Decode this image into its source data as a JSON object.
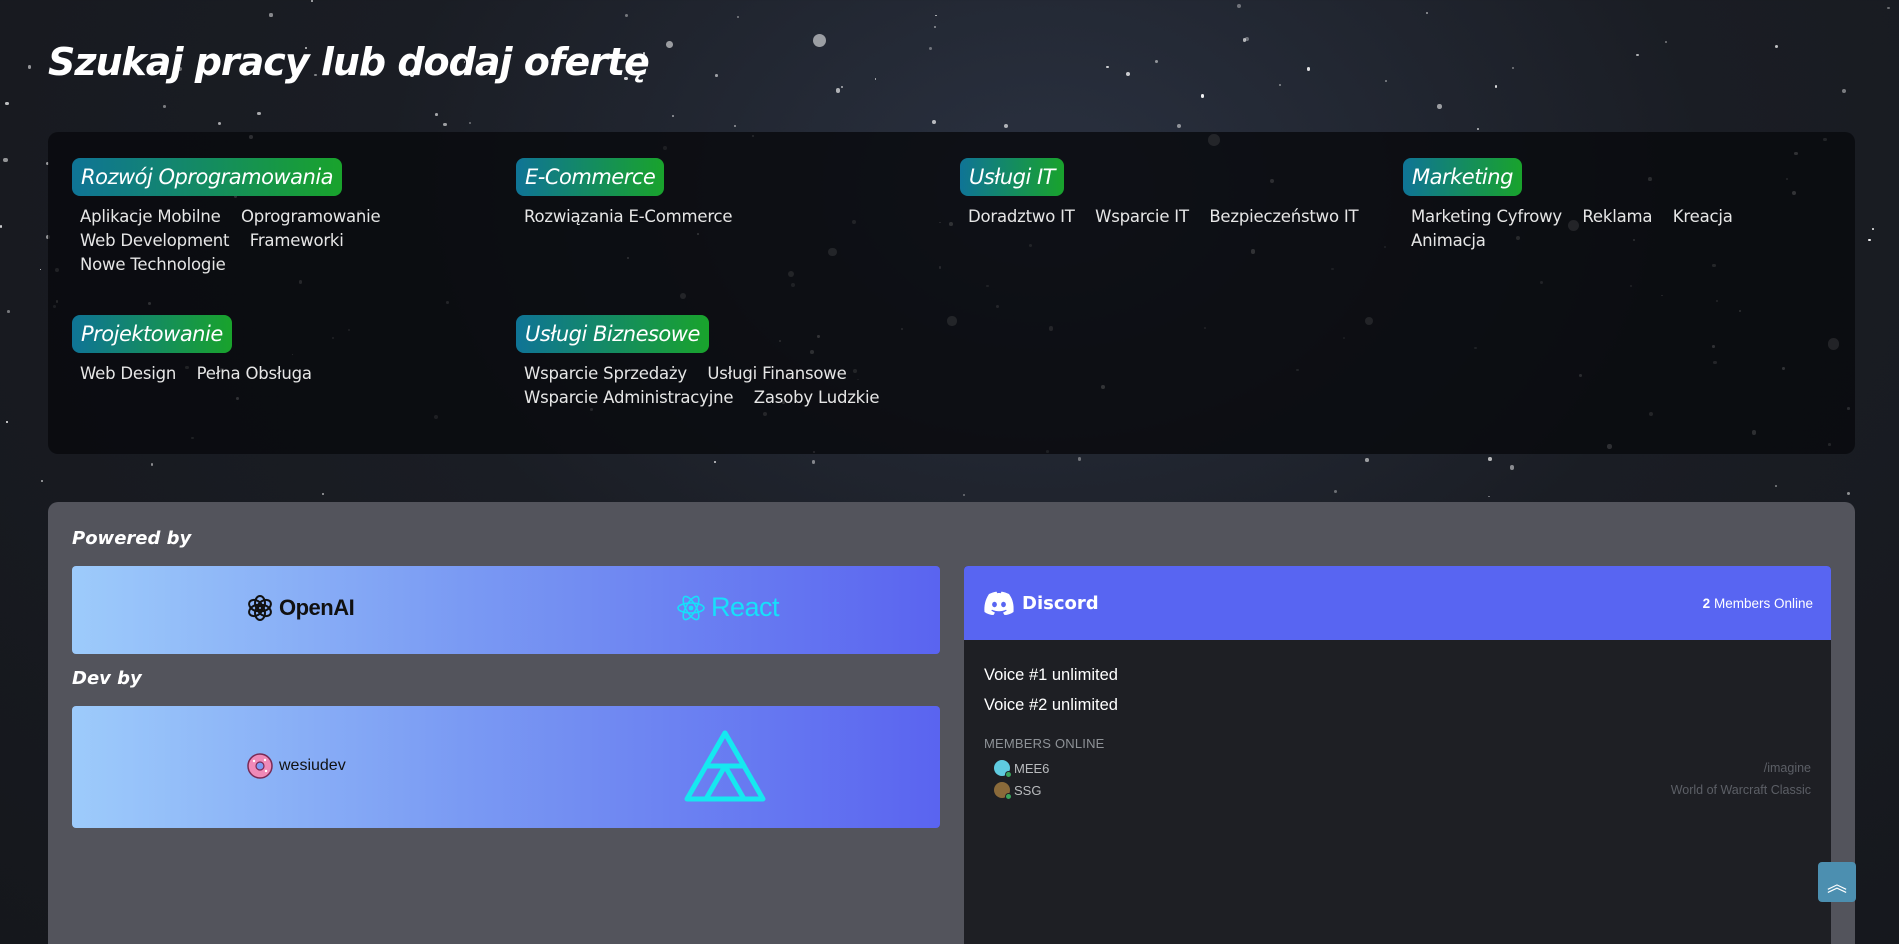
{
  "page": {
    "title": "Szukaj pracy lub dodaj ofertę"
  },
  "categories": [
    {
      "name": "Rozwój Oprogramowania",
      "links": [
        "Aplikacje Mobilne",
        "Oprogramowanie",
        "Web Development",
        "Frameworki",
        "Nowe Technologie"
      ]
    },
    {
      "name": "E-Commerce",
      "links": [
        "Rozwiązania E-Commerce"
      ]
    },
    {
      "name": "Usługi IT",
      "links": [
        "Doradztwo IT",
        "Wsparcie IT",
        "Bezpieczeństwo IT"
      ]
    },
    {
      "name": "Marketing",
      "links": [
        "Marketing Cyfrowy",
        "Reklama",
        "Kreacja",
        "Animacja"
      ]
    },
    {
      "name": "Projektowanie",
      "links": [
        "Web Design",
        "Pełna Obsługa"
      ]
    },
    {
      "name": "Usługi Biznesowe",
      "links": [
        "Wsparcie Sprzedaży",
        "Usługi Finansowe",
        "Wsparcie Administracyjne",
        "Zasoby Ludzkie"
      ]
    }
  ],
  "powered_by": {
    "label": "Powered by",
    "logos": [
      "OpenAI",
      "React"
    ]
  },
  "dev_by": {
    "label": "Dev by",
    "name": "wesiudev"
  },
  "discord": {
    "brand": "Discord",
    "online_count": "2",
    "online_suffix": "Members Online",
    "channels": [
      "Voice #1 unlimited",
      "Voice #2 unlimited"
    ],
    "members_header": "MEMBERS ONLINE",
    "members": [
      {
        "name": "MEE6",
        "activity": "/imagine",
        "avatar_color": "#5fcbe0"
      },
      {
        "name": "SSG",
        "activity": "World of Warcraft Classic",
        "avatar_color": "#8a6a3a"
      }
    ],
    "colors": {
      "header": "#5865f2",
      "body": "#1e1f24"
    }
  },
  "scroll_top": {
    "icon": "double-chevron-up-icon",
    "glyph": "︽"
  },
  "colors": {
    "badge_start": "#0f7496",
    "badge_end": "#19a32c",
    "panel": "#53545c",
    "react": "#16e0fb",
    "logo_gradient_start": "#9dcbfb",
    "logo_gradient_end": "#5a64f0"
  }
}
